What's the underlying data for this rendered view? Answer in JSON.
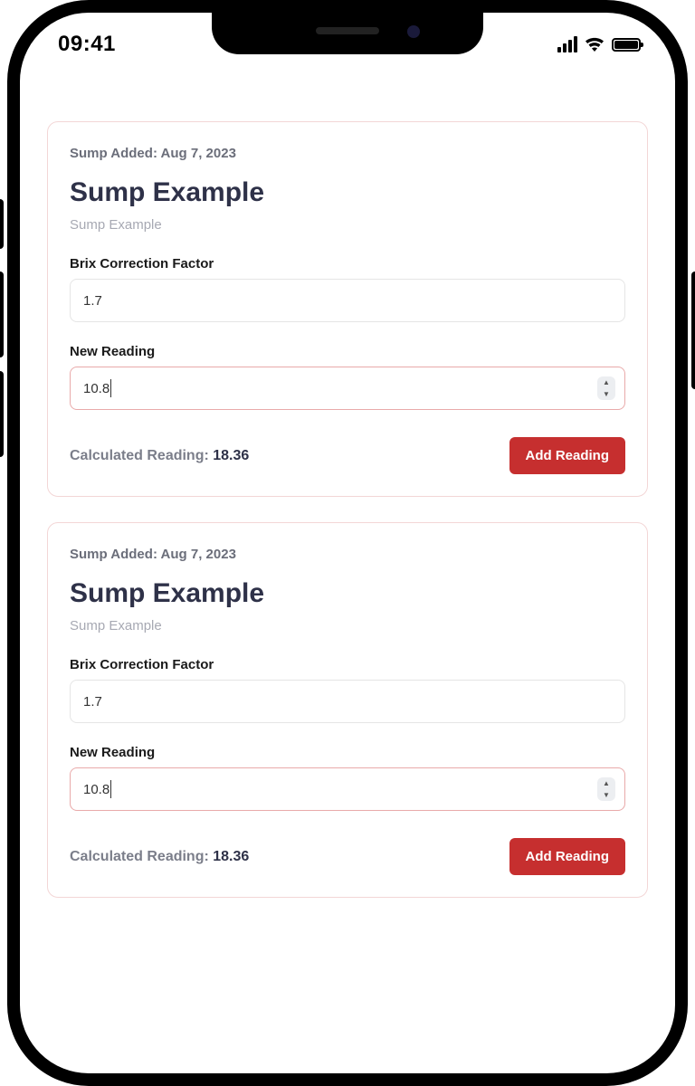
{
  "status": {
    "time": "09:41"
  },
  "cards": [
    {
      "meta": "Sump Added: Aug 7, 2023",
      "title": "Sump Example",
      "subtitle": "Sump Example",
      "brix_label": "Brix Correction Factor",
      "brix_value": "1.7",
      "reading_label": "New Reading",
      "reading_value": "10.8",
      "calc_label": "Calculated Reading: ",
      "calc_value": "18.36",
      "add_label": "Add Reading"
    },
    {
      "meta": "Sump Added: Aug 7, 2023",
      "title": "Sump Example",
      "subtitle": "Sump Example",
      "brix_label": "Brix Correction Factor",
      "brix_value": "1.7",
      "reading_label": "New Reading",
      "reading_value": "10.8",
      "calc_label": "Calculated Reading: ",
      "calc_value": "18.36",
      "add_label": "Add Reading"
    }
  ]
}
